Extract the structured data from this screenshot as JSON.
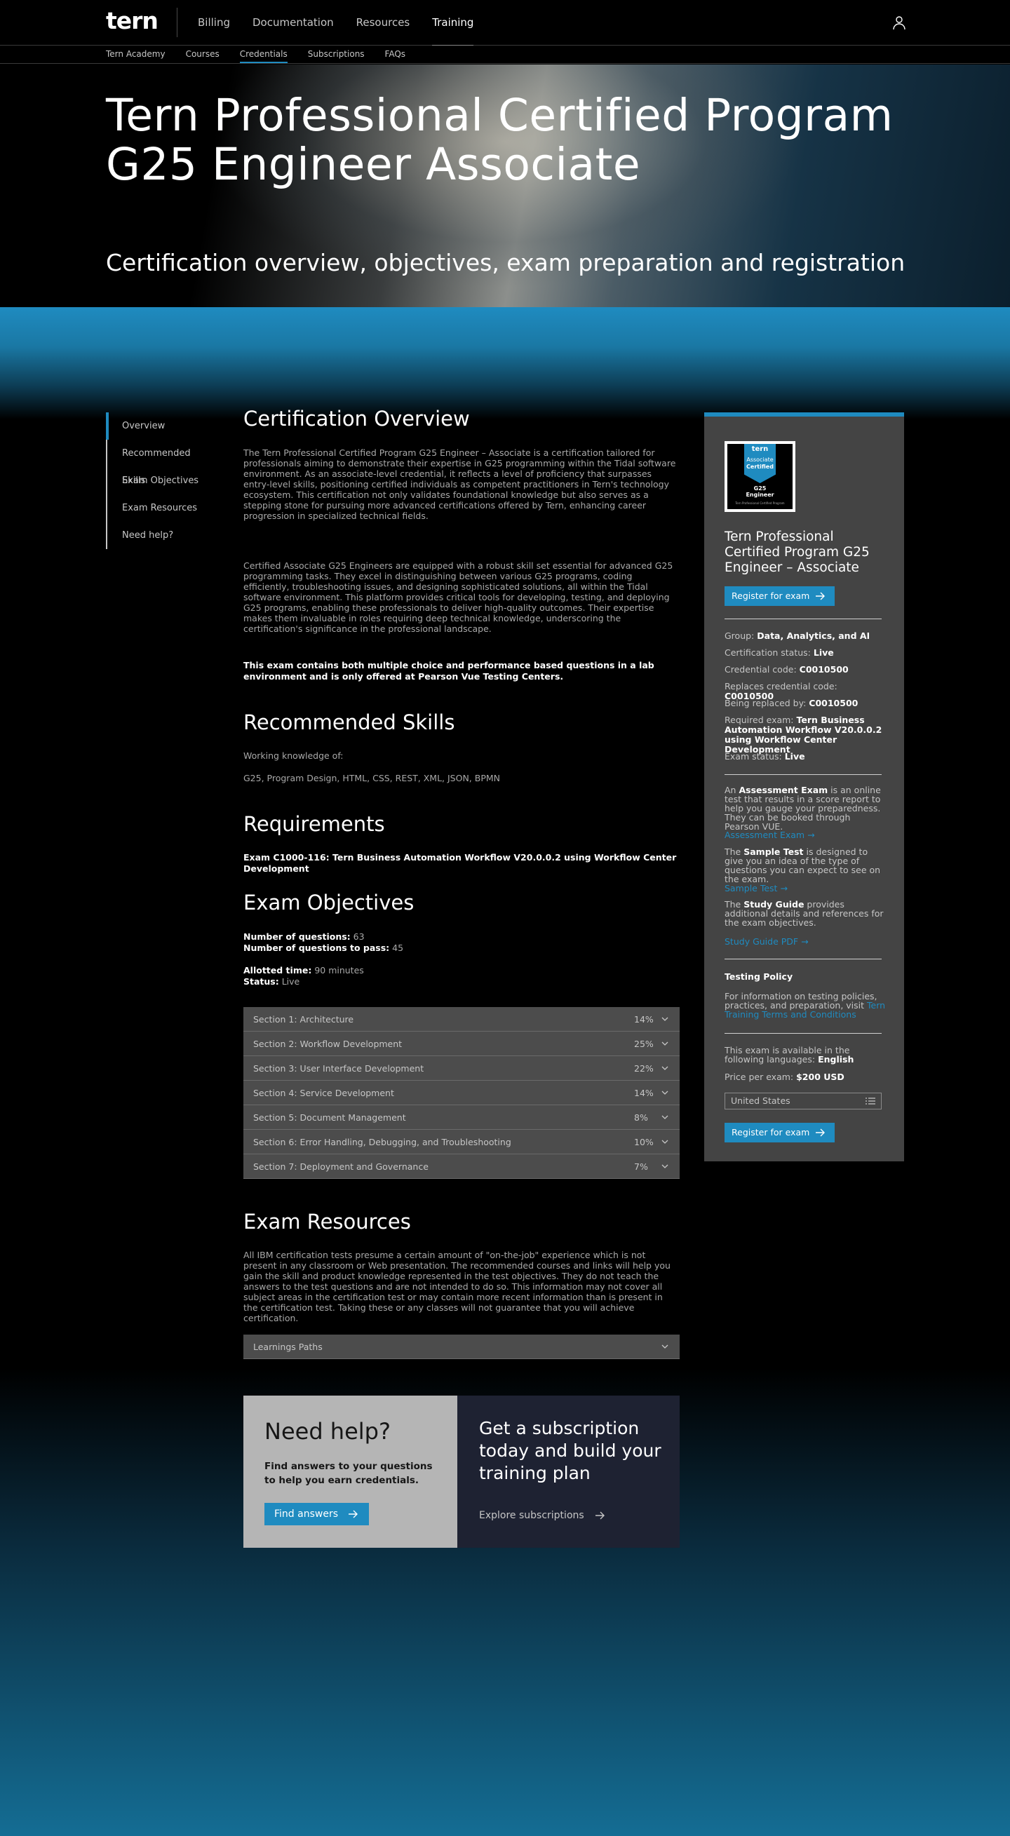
{
  "brand": {
    "logo": "tern",
    "accent": "#1f8bc0"
  },
  "mainnav": [
    "Billing",
    "Documentation",
    "Resources",
    "Training"
  ],
  "mainnav_active": "Training",
  "subnav": [
    "Tern Academy",
    "Courses",
    "Credentials",
    "Subscriptions",
    "FAQs"
  ],
  "subnav_active": "Credentials",
  "hero": {
    "title_line1": "Tern Professional Certified Program",
    "title_line2": "G25 Engineer Associate",
    "subtitle": "Certification overview, objectives, exam preparation and registration"
  },
  "sidemenu": [
    "Overview",
    "Recommended Skills",
    "Exam Objectives",
    "Exam Resources",
    "Need help?"
  ],
  "overview": {
    "heading": "Certification Overview",
    "p1": "The Tern Professional Certified Program G25 Engineer – Associate is a certification tailored for professionals aiming to demonstrate their expertise in G25 programming within the Tidal software environment. As an associate-level credential, it reflects a level of proficiency that surpasses entry-level skills, positioning certified individuals as competent practitioners in Tern's technology ecosystem. This certification not only validates foundational knowledge but also serves as a stepping stone for pursuing more advanced certifications offered by Tern, enhancing career progression in specialized technical fields.",
    "p2": "Certified Associate G25 Engineers are equipped with a robust skill set essential for advanced G25 programming tasks. They excel in distinguishing between various G25 programs, coding efficiently, troubleshooting issues, and designing sophisticated solutions, all within the Tidal software environment. This platform provides critical tools for developing, testing, and deploying G25 programs, enabling these professionals to deliver high-quality outcomes. Their expertise makes them invaluable in roles requiring deep technical knowledge, underscoring the certification's significance in the professional landscape.",
    "note": "This exam contains both multiple choice and performance based questions in a lab environment and is only offered at Pearson Vue Testing Centers."
  },
  "skills": {
    "heading": "Recommended Skills",
    "intro": "Working knowledge of:",
    "list": "G25, Program Design, HTML, CSS, REST, XML, JSON, BPMN"
  },
  "requirements": {
    "heading": "Requirements",
    "text": "Exam C1000-116: Tern Business Automation Workflow V20.0.0.2 using Workflow Center Development"
  },
  "objectives": {
    "heading": "Exam Objectives",
    "num_questions_label": "Number of questions:",
    "num_questions": "63",
    "pass_label": "Number of questions to pass:",
    "pass": "45",
    "time_label": "Allotted time:",
    "time": "90 minutes",
    "status_label": "Status:",
    "status": "Live",
    "sections": [
      {
        "label": "Section 1: Architecture",
        "pct": "14%"
      },
      {
        "label": "Section 2: Workflow Development",
        "pct": "25%"
      },
      {
        "label": "Section 3: User Interface Development",
        "pct": "22%"
      },
      {
        "label": "Section 4: Service Development",
        "pct": "14%"
      },
      {
        "label": "Section 5: Document Management",
        "pct": "8%"
      },
      {
        "label": "Section 6: Error Handling, Debugging, and Troubleshooting",
        "pct": "10%"
      },
      {
        "label": "Section 7: Deployment and Governance",
        "pct": "7%"
      }
    ]
  },
  "resources": {
    "heading": "Exam Resources",
    "text": "All IBM certification tests presume a certain amount of \"on-the-job\" experience which is not present in any classroom or Web presentation. The recommended courses and links will help you gain the skill and product knowledge represented in the test objectives. They do not teach the answers to the test questions and are not intended to do so. This information may not cover all subject areas in the certification test or may contain more recent information than is present in the certification test. Taking these or any classes will not guarantee that you will achieve certification.",
    "accordion": "Learnings Paths"
  },
  "help": {
    "heading": "Need help?",
    "text": "Find answers to your questions to help you earn credentials.",
    "button": "Find answers",
    "sub_heading": "Get a subscription today and build your training plan",
    "sub_link": "Explore subscriptions"
  },
  "card": {
    "badge_top": "tern",
    "badge_mid1": "Associate",
    "badge_mid2": "Certified",
    "badge_g25": "G25",
    "badge_eng": "Engineer",
    "badge_small": "Tern Professional Certified Program",
    "title": "Tern Professional Certified Program G25 Engineer – Associate",
    "register": "Register for exam",
    "group_label": "Group:",
    "group": "Data, Analytics, and AI",
    "cert_status_label": "Certification status:",
    "cert_status": "Live",
    "code_label": "Credential code:",
    "code": "C0010500",
    "replaces_label": "Replaces credential code:",
    "replaces": "C0010500",
    "replaced_by_label": "Being replaced by:",
    "replaced_by": "C0010500",
    "required_label": "Required exam:",
    "required": "Tern Business Automation Workflow V20.0.0.2 using Workflow Center Development",
    "exam_status_label": "Exam status:",
    "exam_status": "Live",
    "assess_pre": "An",
    "assess_bold": "Assessment Exam",
    "assess_post": "is an online test that results in a score report to help you gauge your preparedness. They can be booked through Pearson VUE.",
    "assess_link": "Assessment Exam",
    "sample_pre": "The",
    "sample_bold": "Sample Test",
    "sample_post": "is designed to give you an idea of the type of questions you can expect to see on the exam.",
    "sample_link": "Sample Test",
    "guide_pre": "The",
    "guide_bold": "Study Guide",
    "guide_post": "provides additional details and references for the exam objectives.",
    "guide_link": "Study Guide PDF",
    "policy_heading": "Testing Policy",
    "policy_text": "For information on testing policies, practices, and preparation, visit",
    "policy_link": "Tern Training Terms and Conditions",
    "lang_text": "This exam is available in the following languages:",
    "lang": "English",
    "price_label": "Price per exam:",
    "price": "$200 USD",
    "country": "United States"
  }
}
